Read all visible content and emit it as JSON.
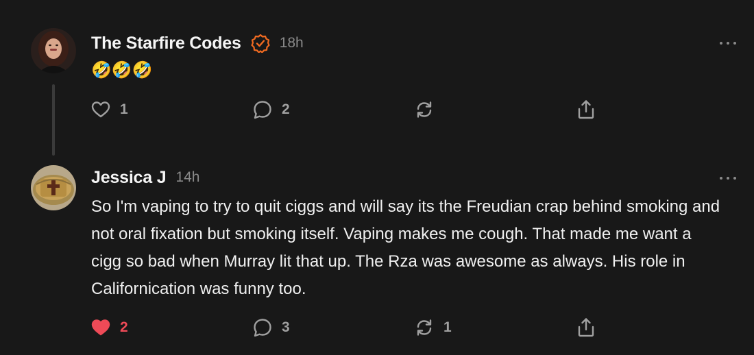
{
  "comments": [
    {
      "author": "The Starfire Codes",
      "verified": true,
      "time": "18h",
      "text": "🤣🤣🤣",
      "likes": "1",
      "liked": false,
      "replies": "2",
      "restacks": "",
      "avatar": "woman-portrait-avatar"
    },
    {
      "author": "Jessica J",
      "verified": false,
      "time": "14h",
      "text": "So I'm vaping to try to quit ciggs and will say its the Freudian crap behind smoking and not oral fixation but smoking itself. Vaping makes me cough. That made me want a cigg so bad when Murray lit that up. The Rza was awesome as always. His role in Californication was funny too.",
      "likes": "2",
      "liked": true,
      "replies": "3",
      "restacks": "1",
      "avatar": "gold-cross-ring-avatar"
    }
  ],
  "colors": {
    "background": "#181818",
    "accent_verified": "#f26b21",
    "liked": "#ee4a57",
    "muted": "#8a8a8a"
  },
  "icons": [
    "heart-icon",
    "comment-icon",
    "restack-icon",
    "share-icon",
    "more-options-icon",
    "verified-badge-icon"
  ]
}
